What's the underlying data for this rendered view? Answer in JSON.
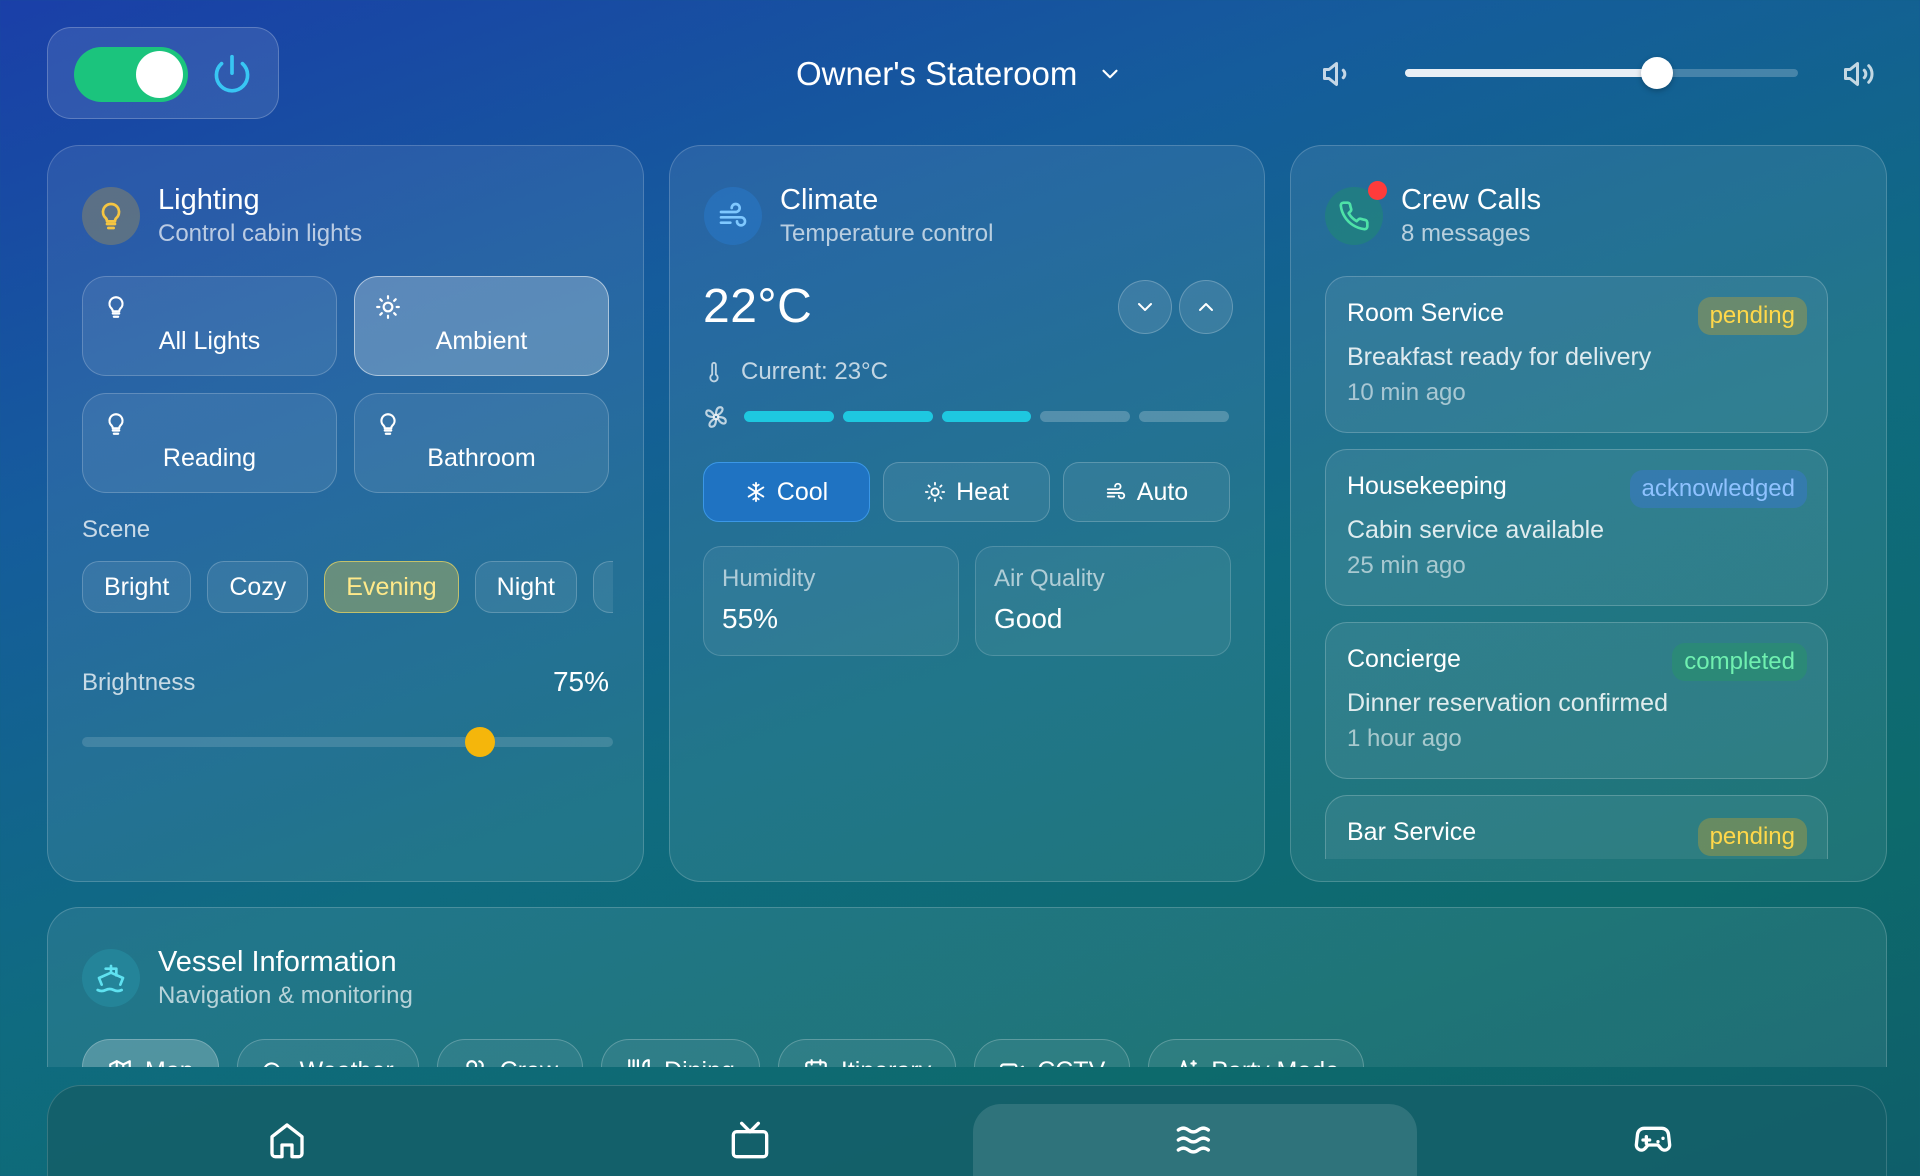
{
  "header": {
    "power_on": true,
    "room": "Owner's Stateroom",
    "volume": 0.64
  },
  "lighting": {
    "title": "Lighting",
    "subtitle": "Control cabin lights",
    "tiles": [
      {
        "label": "All Lights",
        "icon": "bulb-icon",
        "active": false
      },
      {
        "label": "Ambient",
        "icon": "sun-icon",
        "active": true
      },
      {
        "label": "Reading",
        "icon": "bulb-icon",
        "active": false
      },
      {
        "label": "Bathroom",
        "icon": "bulb-icon",
        "active": false
      }
    ],
    "scene_label": "Scene",
    "scenes": [
      "Bright",
      "Cozy",
      "Evening",
      "Night",
      ""
    ],
    "active_scene": "Evening",
    "brightness_label": "Brightness",
    "brightness_value": "75%",
    "brightness": 0.75
  },
  "climate": {
    "title": "Climate",
    "subtitle": "Temperature control",
    "temperature": "22°C",
    "current": "Current: 23°C",
    "fan_level": 3,
    "fan_levels_total": 5,
    "modes": [
      {
        "label": "Cool",
        "icon": "snowflake-icon",
        "active": true
      },
      {
        "label": "Heat",
        "icon": "sun-icon",
        "active": false
      },
      {
        "label": "Auto",
        "icon": "wind-icon",
        "active": false
      }
    ],
    "humidity_label": "Humidity",
    "humidity_value": "55%",
    "air_label": "Air Quality",
    "air_value": "Good",
    "accent": "#1ec8e0"
  },
  "crew_calls": {
    "title": "Crew Calls",
    "subtitle": "8 messages",
    "items": [
      {
        "name": "Room Service",
        "status": "pending",
        "message": "Breakfast ready for delivery",
        "time": "10 min ago"
      },
      {
        "name": "Housekeeping",
        "status": "acknowledged",
        "message": "Cabin service available",
        "time": "25 min ago"
      },
      {
        "name": "Concierge",
        "status": "completed",
        "message": "Dinner reservation confirmed",
        "time": "1 hour ago"
      },
      {
        "name": "Bar Service",
        "status": "pending",
        "message": "",
        "time": ""
      }
    ]
  },
  "vessel": {
    "title": "Vessel Information",
    "subtitle": "Navigation & monitoring",
    "tabs": [
      {
        "label": "Map",
        "icon": "map-icon",
        "active": true
      },
      {
        "label": "Weather",
        "icon": "cloud-icon",
        "active": false
      },
      {
        "label": "Crew",
        "icon": "users-icon",
        "active": false
      },
      {
        "label": "Dining",
        "icon": "utensils-icon",
        "active": false
      },
      {
        "label": "Itinerary",
        "icon": "calendar-icon",
        "active": false
      },
      {
        "label": "CCTV",
        "icon": "video-icon",
        "active": false
      },
      {
        "label": "Party Mode",
        "icon": "sparkles-icon",
        "active": false
      }
    ]
  },
  "bottom_nav": [
    {
      "icon": "home-icon",
      "active": false
    },
    {
      "icon": "tv-icon",
      "active": false
    },
    {
      "icon": "waves-icon",
      "active": true
    },
    {
      "icon": "gamepad-icon",
      "active": false
    }
  ]
}
